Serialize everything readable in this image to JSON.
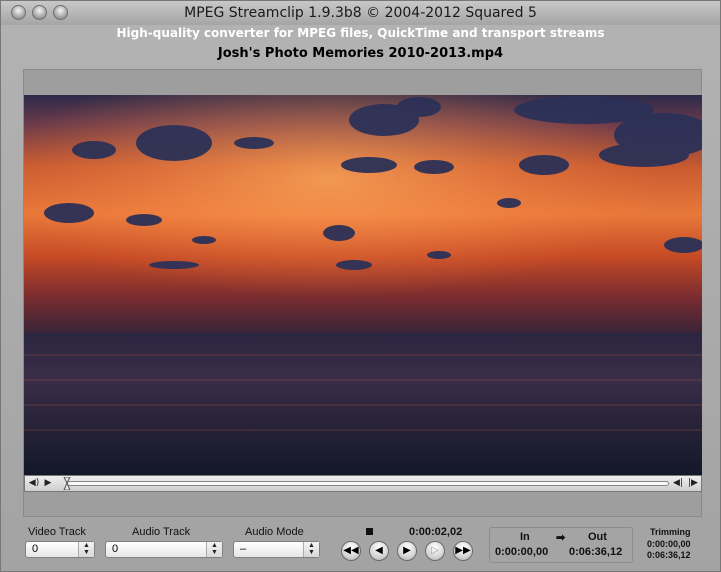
{
  "window": {
    "title": "MPEG Streamclip 1.9.3b8  ©  2004-2012 Squared 5",
    "subtitle": "High-quality converter for MPEG files, QuickTime and transport streams",
    "filename": "Josh's Photo Memories 2010-2013.mp4"
  },
  "controls": {
    "video_track_label": "Video Track",
    "video_track_value": "0",
    "audio_track_label": "Audio Track",
    "audio_track_value": "0",
    "audio_mode_label": "Audio Mode",
    "audio_mode_value": "–",
    "current_time": "0:00:02,02"
  },
  "transport": {
    "rewind": "◀◀",
    "step_back": "◀",
    "play": "▶",
    "step_forward": "▷",
    "fast_forward": "▶▶"
  },
  "inout": {
    "in_label": "In",
    "out_label": "Out",
    "arrow": "➡",
    "in_time": "0:00:00,00",
    "out_time": "0:06:36,12"
  },
  "trimming": {
    "label": "Trimming",
    "start": "0:00:00,00",
    "end": "0:06:36,12"
  },
  "scrubber": {
    "volume_icon": "◀)",
    "play_icon": "▶",
    "step_back_icon": "◀|",
    "step_forward_icon": "|▶"
  },
  "colors": {
    "sky_orange": "#e0652a",
    "sky_dark": "#24284a",
    "sea": "#1c1f35"
  }
}
